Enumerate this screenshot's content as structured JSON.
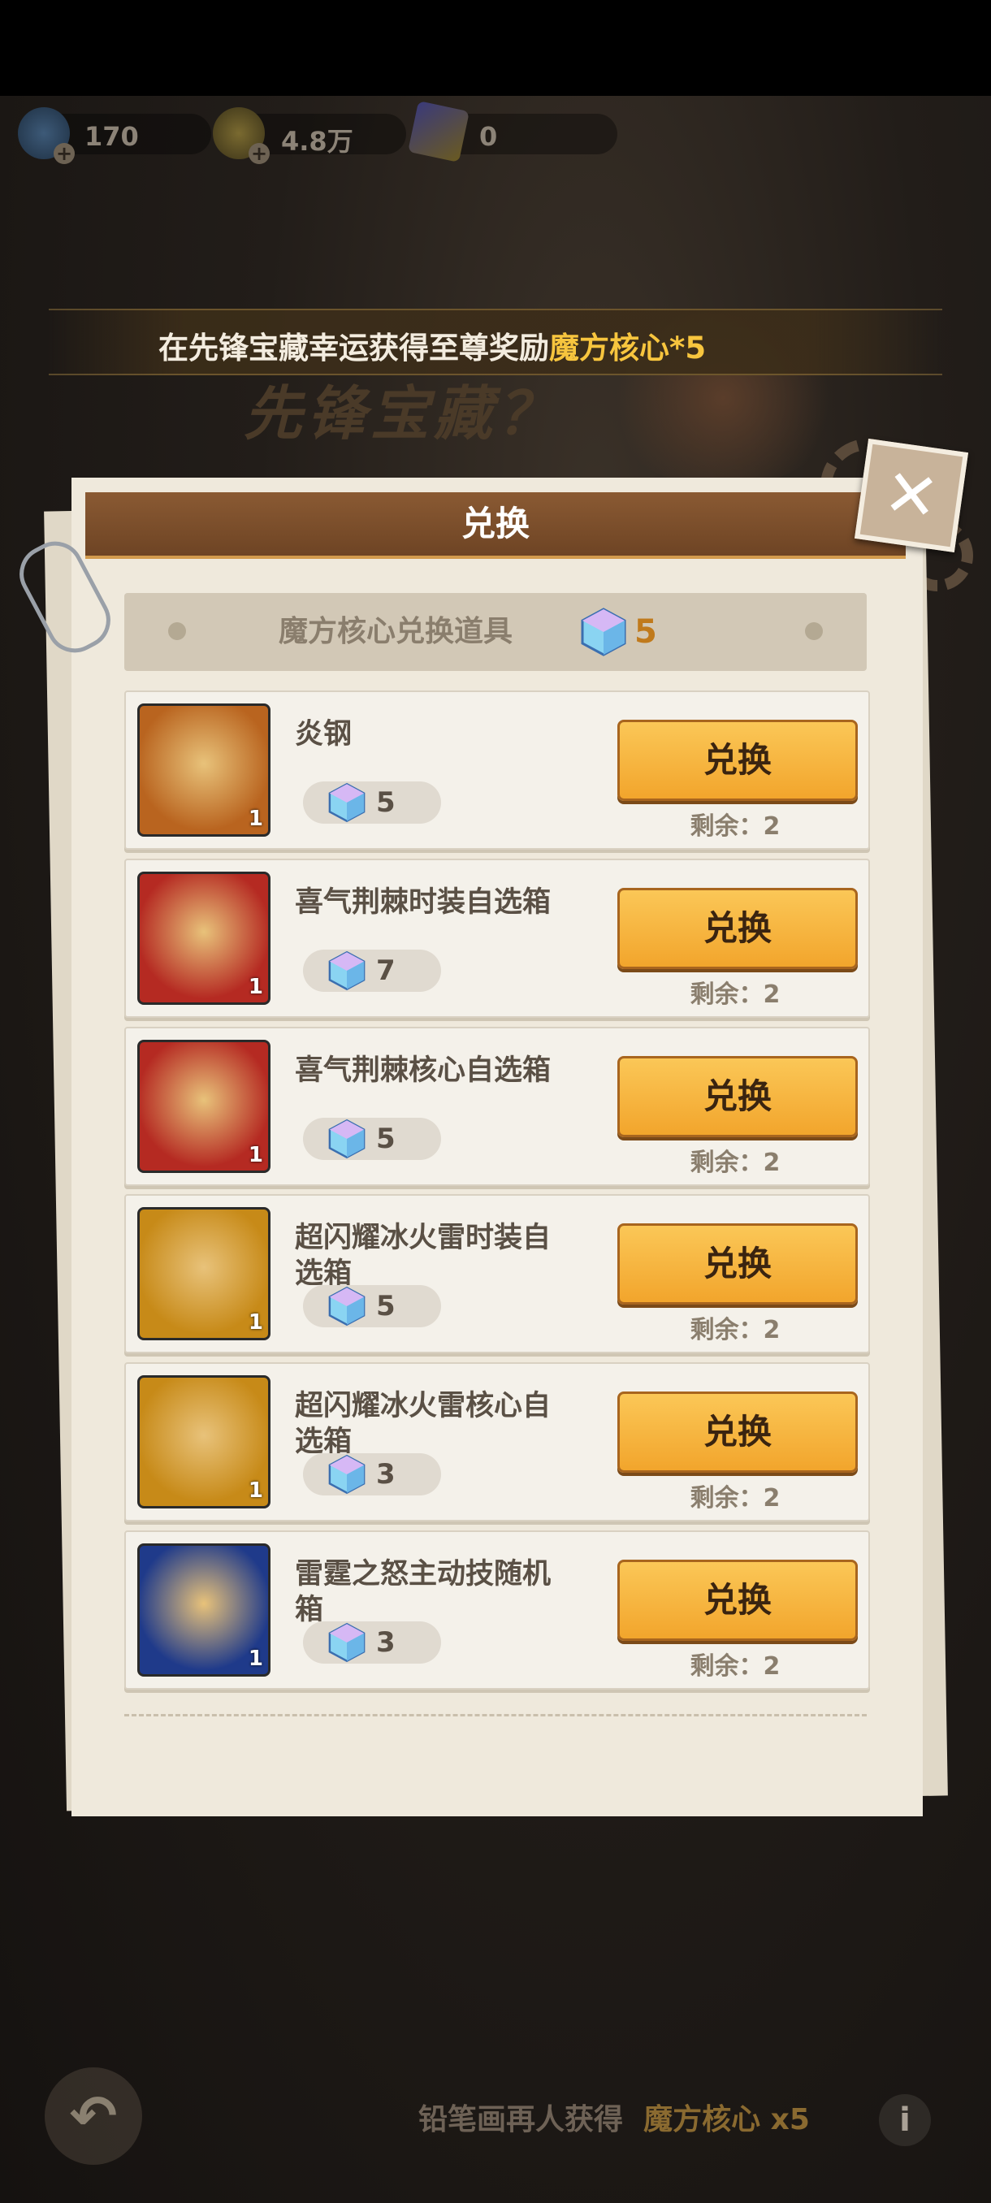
{
  "resources": [
    {
      "icon": "gem-plus-icon",
      "value": "170"
    },
    {
      "icon": "coin-plus-icon",
      "value": "4.8万"
    },
    {
      "icon": "ticket-icon",
      "value": "0"
    }
  ],
  "banner": {
    "prefix": "在先锋宝藏幸运获得至尊奖励",
    "highlight": "魔方核心*5"
  },
  "background_title": "先锋宝藏？",
  "dialog": {
    "title": "兑换",
    "sub_title": "魔方核心兑换道具",
    "currency_count": "5",
    "button_label": "兑换",
    "items": [
      {
        "name": "炎钢",
        "cost": "5",
        "remain": "剩余：2",
        "qty": "1",
        "icon": "mecha-icon",
        "color": "#b9641f"
      },
      {
        "name": "喜气荆棘时装自选箱",
        "cost": "7",
        "remain": "剩余：2",
        "qty": "1",
        "icon": "gift-box-icon",
        "color": "#b52a22"
      },
      {
        "name": "喜气荆棘核心自选箱",
        "cost": "5",
        "remain": "剩余：2",
        "qty": "1",
        "icon": "chest-icon",
        "color": "#b52a22"
      },
      {
        "name": "超闪耀冰火雷时装自选箱",
        "cost": "5",
        "remain": "剩余：2",
        "qty": "1",
        "icon": "gift-box-icon",
        "color": "#c78a18"
      },
      {
        "name": "超闪耀冰火雷核心自选箱",
        "cost": "3",
        "remain": "剩余：2",
        "qty": "1",
        "icon": "chest-icon",
        "color": "#c78a18"
      },
      {
        "name": "雷霆之怒主动技随机箱",
        "cost": "3",
        "remain": "剩余：2",
        "qty": "1",
        "icon": "thunder-chest-icon",
        "color": "#1f3a8a"
      }
    ]
  },
  "bottom": {
    "text": "铅笔画再人获得",
    "highlight": "魔方核心 x5"
  }
}
